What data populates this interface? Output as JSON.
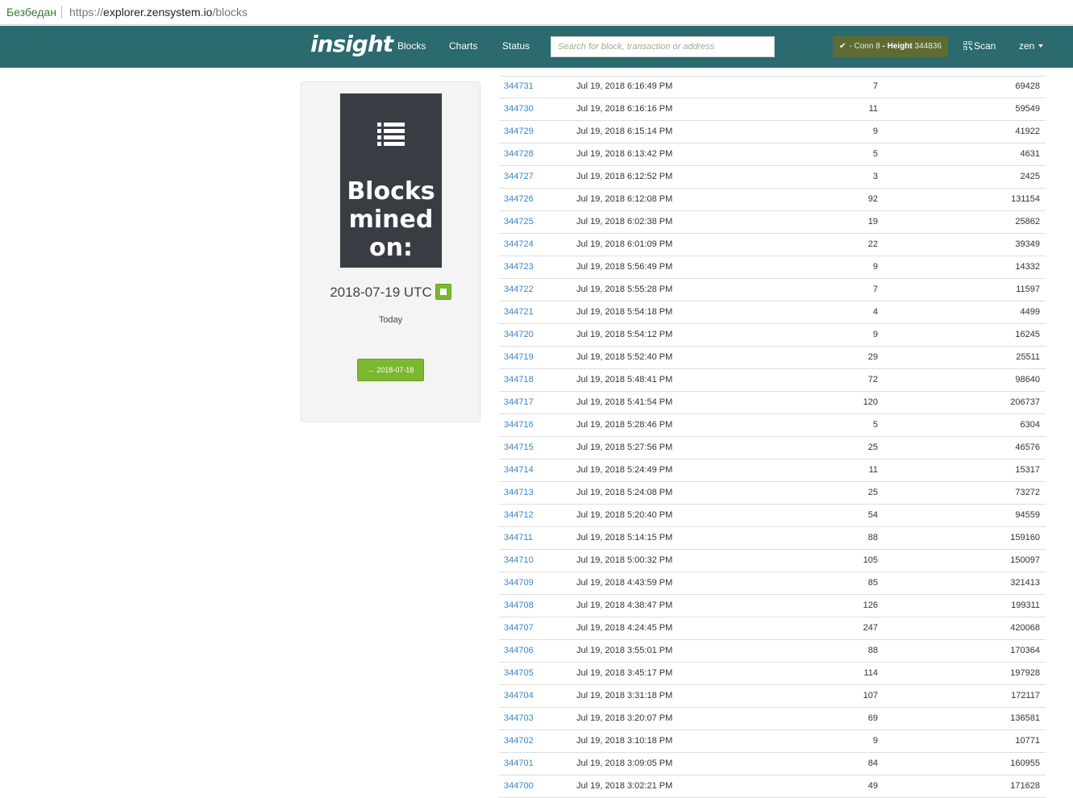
{
  "browser": {
    "security_label": "Безбедан",
    "url_scheme": "https://",
    "url_host": "explorer.zensystem.io",
    "url_path": "/blocks"
  },
  "navbar": {
    "brand": "insight",
    "links": [
      "Blocks",
      "Charts",
      "Status"
    ],
    "search_placeholder": "Search for block, transaction or address",
    "status": {
      "prefix": "- Conn",
      "conn": "8",
      "height_label": "- Height",
      "height": "344836"
    },
    "scan_label": "Scan",
    "currency": "zen",
    "colors": {
      "bar": "#2b6a6e",
      "badge": "#5d6b35"
    }
  },
  "sidebar": {
    "headline": "Blocks mined on:",
    "date": "2018-07-19 UTC",
    "today": "Today",
    "prev_button": "← 2018-07-18",
    "accent": "#7cb82f"
  },
  "blocks": [
    {
      "height": "344731",
      "time": "Jul 19, 2018 6:16:49 PM",
      "txs": "7",
      "size": "69428"
    },
    {
      "height": "344730",
      "time": "Jul 19, 2018 6:16:16 PM",
      "txs": "11",
      "size": "59549"
    },
    {
      "height": "344729",
      "time": "Jul 19, 2018 6:15:14 PM",
      "txs": "9",
      "size": "41922"
    },
    {
      "height": "344728",
      "time": "Jul 19, 2018 6:13:42 PM",
      "txs": "5",
      "size": "4631"
    },
    {
      "height": "344727",
      "time": "Jul 19, 2018 6:12:52 PM",
      "txs": "3",
      "size": "2425"
    },
    {
      "height": "344726",
      "time": "Jul 19, 2018 6:12:08 PM",
      "txs": "92",
      "size": "131154"
    },
    {
      "height": "344725",
      "time": "Jul 19, 2018 6:02:38 PM",
      "txs": "19",
      "size": "25862"
    },
    {
      "height": "344724",
      "time": "Jul 19, 2018 6:01:09 PM",
      "txs": "22",
      "size": "39349"
    },
    {
      "height": "344723",
      "time": "Jul 19, 2018 5:56:49 PM",
      "txs": "9",
      "size": "14332"
    },
    {
      "height": "344722",
      "time": "Jul 19, 2018 5:55:28 PM",
      "txs": "7",
      "size": "11597"
    },
    {
      "height": "344721",
      "time": "Jul 19, 2018 5:54:18 PM",
      "txs": "4",
      "size": "4499"
    },
    {
      "height": "344720",
      "time": "Jul 19, 2018 5:54:12 PM",
      "txs": "9",
      "size": "16245"
    },
    {
      "height": "344719",
      "time": "Jul 19, 2018 5:52:40 PM",
      "txs": "29",
      "size": "25511"
    },
    {
      "height": "344718",
      "time": "Jul 19, 2018 5:48:41 PM",
      "txs": "72",
      "size": "98640"
    },
    {
      "height": "344717",
      "time": "Jul 19, 2018 5:41:54 PM",
      "txs": "120",
      "size": "206737"
    },
    {
      "height": "344716",
      "time": "Jul 19, 2018 5:28:46 PM",
      "txs": "5",
      "size": "6304"
    },
    {
      "height": "344715",
      "time": "Jul 19, 2018 5:27:56 PM",
      "txs": "25",
      "size": "46576"
    },
    {
      "height": "344714",
      "time": "Jul 19, 2018 5:24:49 PM",
      "txs": "11",
      "size": "15317"
    },
    {
      "height": "344713",
      "time": "Jul 19, 2018 5:24:08 PM",
      "txs": "25",
      "size": "73272"
    },
    {
      "height": "344712",
      "time": "Jul 19, 2018 5:20:40 PM",
      "txs": "54",
      "size": "94559"
    },
    {
      "height": "344711",
      "time": "Jul 19, 2018 5:14:15 PM",
      "txs": "88",
      "size": "159160"
    },
    {
      "height": "344710",
      "time": "Jul 19, 2018 5:00:32 PM",
      "txs": "105",
      "size": "150097"
    },
    {
      "height": "344709",
      "time": "Jul 19, 2018 4:43:59 PM",
      "txs": "85",
      "size": "321413"
    },
    {
      "height": "344708",
      "time": "Jul 19, 2018 4:38:47 PM",
      "txs": "126",
      "size": "199311"
    },
    {
      "height": "344707",
      "time": "Jul 19, 2018 4:24:45 PM",
      "txs": "247",
      "size": "420068"
    },
    {
      "height": "344706",
      "time": "Jul 19, 2018 3:55:01 PM",
      "txs": "88",
      "size": "170364"
    },
    {
      "height": "344705",
      "time": "Jul 19, 2018 3:45:17 PM",
      "txs": "114",
      "size": "197928"
    },
    {
      "height": "344704",
      "time": "Jul 19, 2018 3:31:18 PM",
      "txs": "107",
      "size": "172117"
    },
    {
      "height": "344703",
      "time": "Jul 19, 2018 3:20:07 PM",
      "txs": "69",
      "size": "136581"
    },
    {
      "height": "344702",
      "time": "Jul 19, 2018 3:10:18 PM",
      "txs": "9",
      "size": "10771"
    },
    {
      "height": "344701",
      "time": "Jul 19, 2018 3:09:05 PM",
      "txs": "84",
      "size": "160955"
    },
    {
      "height": "344700",
      "time": "Jul 19, 2018 3:02:21 PM",
      "txs": "49",
      "size": "171628"
    }
  ]
}
